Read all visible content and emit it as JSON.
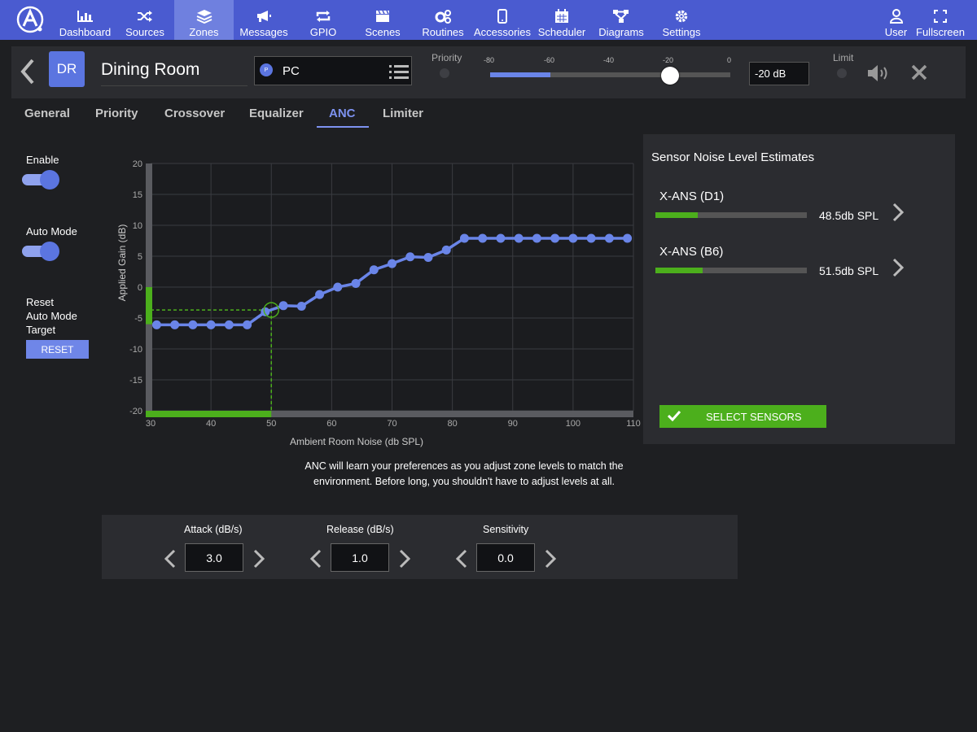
{
  "nav": {
    "items": [
      {
        "label": "Dashboard",
        "icon": "dashboard-icon"
      },
      {
        "label": "Sources",
        "icon": "shuffle-icon"
      },
      {
        "label": "Zones",
        "icon": "layers-icon",
        "active": true
      },
      {
        "label": "Messages",
        "icon": "megaphone-icon"
      },
      {
        "label": "GPIO",
        "icon": "repeat-icon"
      },
      {
        "label": "Scenes",
        "icon": "clapperboard-icon"
      },
      {
        "label": "Routines",
        "icon": "cogs-icon"
      },
      {
        "label": "Accessories",
        "icon": "phone-icon"
      },
      {
        "label": "Scheduler",
        "icon": "calendar-icon"
      },
      {
        "label": "Diagrams",
        "icon": "sitemap-icon"
      },
      {
        "label": "Settings",
        "icon": "gear-icon"
      }
    ],
    "right": [
      {
        "label": "User",
        "icon": "user-icon"
      },
      {
        "label": "Fullscreen",
        "icon": "fullscreen-icon"
      }
    ],
    "color": "#4a5bd0",
    "active_color": "#6f80df"
  },
  "zone": {
    "initials": "DR",
    "name": "Dining Room",
    "source_badge": "P",
    "source": "PC",
    "priority_label": "Priority",
    "limit_label": "Limit",
    "volume_ticks": [
      "-80",
      "-60",
      "-40",
      "-20",
      "0"
    ],
    "volume_db": -20,
    "volume_text": "-20 dB",
    "meter_level_db": -60
  },
  "tabs": [
    {
      "label": "General"
    },
    {
      "label": "Priority"
    },
    {
      "label": "Crossover"
    },
    {
      "label": "Equalizer"
    },
    {
      "label": "ANC",
      "active": true
    },
    {
      "label": "Limiter"
    }
  ],
  "controls": {
    "enable_label": "Enable",
    "enable_on": true,
    "auto_mode_label": "Auto Mode",
    "auto_mode_on": true,
    "reset_label_lines": [
      "Reset",
      "Auto Mode",
      "Target"
    ],
    "reset_button": "RESET"
  },
  "chart_data": {
    "type": "line",
    "xlabel": "Ambient Room Noise (db SPL)",
    "ylabel": "Applied Gain (dB)",
    "xlim": [
      30,
      110
    ],
    "ylim": [
      -20,
      20
    ],
    "xticks": [
      "30",
      "40",
      "50",
      "60",
      "70",
      "80",
      "90",
      "100",
      "110"
    ],
    "yticks": [
      "20",
      "15",
      "10",
      "5",
      "0",
      "-5",
      "-10",
      "-15",
      "-20"
    ],
    "grid": true,
    "x": [
      31,
      34,
      37,
      40,
      43,
      46,
      49,
      52,
      55,
      58,
      61,
      64,
      67,
      70,
      73,
      76,
      79,
      82,
      85,
      88,
      91,
      94,
      97,
      100,
      103,
      106,
      109
    ],
    "y": [
      -6.1,
      -6.1,
      -6.1,
      -6.1,
      -6.1,
      -6.1,
      -4,
      -3,
      -3.1,
      -1.2,
      0,
      0.6,
      2.8,
      3.8,
      4.9,
      4.8,
      6,
      7.9,
      7.9,
      7.9,
      7.9,
      7.9,
      7.9,
      7.9,
      7.9,
      7.9,
      7.9
    ],
    "marker": {
      "x": 50,
      "y": -3.7
    },
    "current_noise_range": [
      30,
      50
    ],
    "current_gain_range": [
      -6,
      0
    ],
    "line_color": "#6a85e8",
    "accent_color": "#4caf1c"
  },
  "anc_note": "ANC will learn your preferences as you adjust zone levels to match the environment. Before long, you shouldn't have to adjust levels at all.",
  "sensors": {
    "title": "Sensor Noise Level Estimates",
    "items": [
      {
        "name": "X-ANS (D1)",
        "value": "48.5db SPL",
        "level": 0.28
      },
      {
        "name": "X-ANS (B6)",
        "value": "51.5db SPL",
        "level": 0.31
      }
    ],
    "button": "SELECT SENSORS"
  },
  "params": [
    {
      "label": "Attack (dB/s)",
      "value": "3.0"
    },
    {
      "label": "Release (dB/s)",
      "value": "1.0"
    },
    {
      "label": "Sensitivity",
      "value": "0.0"
    }
  ]
}
